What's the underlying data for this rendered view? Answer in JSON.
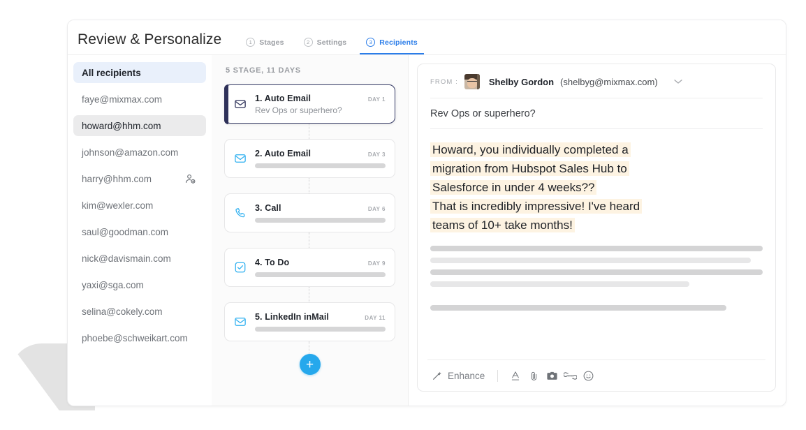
{
  "header": {
    "title": "Review & Personalize",
    "tabs": [
      {
        "num": "1",
        "label": "Stages",
        "active": false
      },
      {
        "num": "2",
        "label": "Settings",
        "active": false
      },
      {
        "num": "3",
        "label": "Recipients",
        "active": true
      }
    ]
  },
  "recipients": {
    "items": [
      {
        "label": "All recipients",
        "state": "all",
        "icon": ""
      },
      {
        "label": "faye@mixmax.com",
        "state": "normal",
        "icon": ""
      },
      {
        "label": "howard@hhm.com",
        "state": "selected",
        "icon": ""
      },
      {
        "label": "johnson@amazon.com",
        "state": "normal",
        "icon": ""
      },
      {
        "label": "harry@hhm.com",
        "state": "normal",
        "icon": "person-badge-icon"
      },
      {
        "label": "kim@wexler.com",
        "state": "normal",
        "icon": ""
      },
      {
        "label": "saul@goodman.com",
        "state": "normal",
        "icon": ""
      },
      {
        "label": "nick@davismain.com",
        "state": "normal",
        "icon": ""
      },
      {
        "label": "yaxi@sga.com",
        "state": "normal",
        "icon": ""
      },
      {
        "label": "selina@cokely.com",
        "state": "normal",
        "icon": ""
      },
      {
        "label": "phoebe@schweikart.com",
        "state": "normal",
        "icon": ""
      }
    ]
  },
  "stages": {
    "heading": "5 STAGE, 11 DAYS",
    "add_label": "+",
    "items": [
      {
        "title": "1. Auto Email",
        "day": "DAY 1",
        "subtitle": "Rev Ops or superhero?",
        "icon": "envelope-icon",
        "active": true
      },
      {
        "title": "2. Auto Email",
        "day": "DAY 3",
        "subtitle": "",
        "icon": "envelope-icon",
        "active": false
      },
      {
        "title": "3. Call",
        "day": "DAY 6",
        "subtitle": "",
        "icon": "phone-icon",
        "active": false
      },
      {
        "title": "4. To Do",
        "day": "DAY 9",
        "subtitle": "",
        "icon": "checkbox-icon",
        "active": false
      },
      {
        "title": "5. LinkedIn inMail",
        "day": "DAY 11",
        "subtitle": "",
        "icon": "envelope-icon",
        "active": false
      }
    ]
  },
  "email": {
    "from_label": "FROM :",
    "sender_name": "Shelby Gordon",
    "sender_email": "(shelbyg@mixmax.com)",
    "subject": "Rev Ops or superhero?",
    "body_lines": [
      "Howard, you individually completed a",
      "migration from Hubspot Sales Hub to",
      "Salesforce in under 4 weeks??",
      "That is incredibly impressive! I've heard",
      "teams of 10+ take months!"
    ],
    "toolbar": {
      "enhance_label": "Enhance",
      "icons": [
        "magic-wand-icon",
        "text-format-icon",
        "attachment-icon",
        "camera-icon",
        "link-icon",
        "emoji-icon"
      ]
    }
  },
  "colors": {
    "accent_blue": "#2b7de9",
    "icon_blue": "#2fb0f0",
    "active_navy": "#2e3159",
    "highlight": "#fdf3e2",
    "add_button": "#26a8ec"
  }
}
